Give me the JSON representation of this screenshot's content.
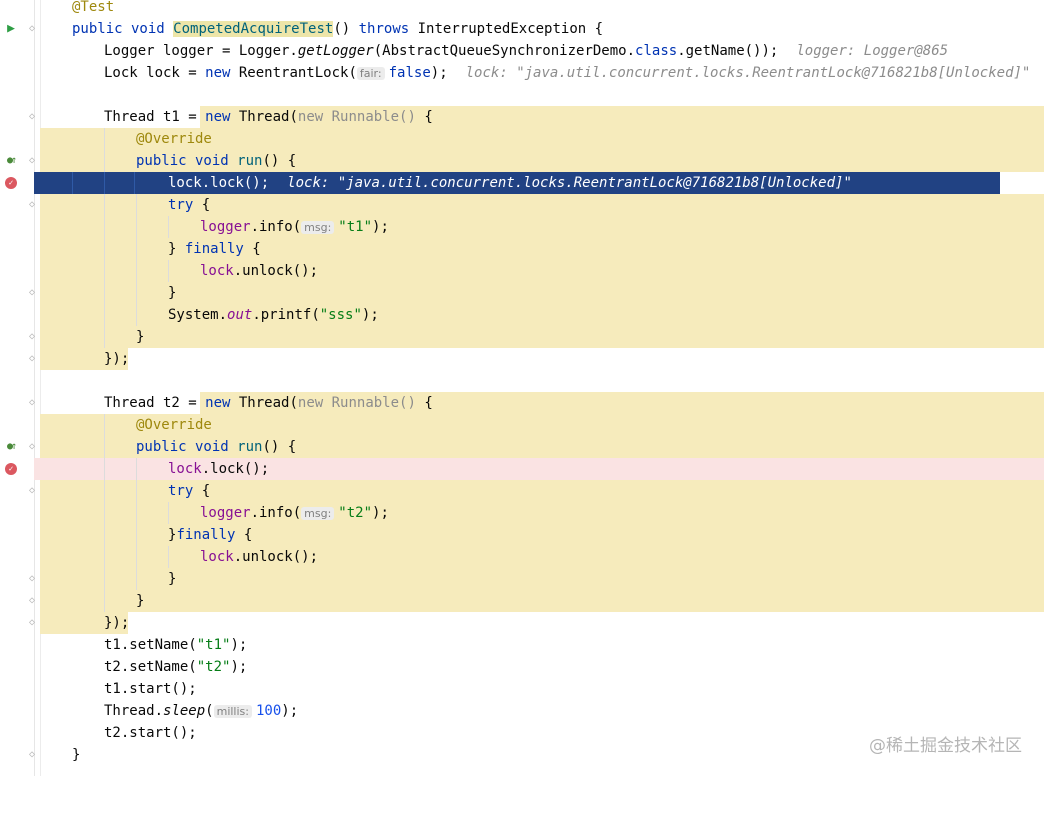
{
  "editor": {
    "lines": {
      "l0": {
        "ann": "@Test"
      },
      "l1": {
        "kw1": "public void ",
        "fn": "CompetedAcquireTest",
        "rest1": "() ",
        "kw2": "throws",
        "rest2": " InterruptedException {"
      },
      "l2": {
        "a": "Logger logger = Logger.",
        "b": "getLogger",
        "c": "(AbstractQueueSynchronizerDemo.",
        "d": "class",
        "e": ".getName());",
        "inline": "logger: Logger@865"
      },
      "l3": {
        "a": "Lock lock = ",
        "kw": "new",
        "b": " ReentrantLock(",
        "hint": "fair:",
        "kw2": "false",
        "c": ");",
        "inline": "lock: \"java.util.concurrent.locks.ReentrantLock@716821b8[Unlocked]\""
      },
      "l5": {
        "a": "Thread t1 = ",
        "kw": "new",
        "b": " Thread(",
        "faded": "new Runnable()",
        "c": " {"
      },
      "l6": {
        "ann": "@Override"
      },
      "l7": {
        "kw": "public void ",
        "fn": "run",
        "b": "() {"
      },
      "l8": {
        "fld": "lock",
        "a": ".lock();",
        "inline": "lock: \"java.util.concurrent.locks.ReentrantLock@716821b8[Unlocked]\""
      },
      "l9": {
        "kw": "try",
        "a": " {"
      },
      "l10": {
        "fld": "logger",
        "a": ".info(",
        "hint": "msg:",
        "str": "\"t1\"",
        "b": ");"
      },
      "l11": {
        "a": "} ",
        "kw": "finally",
        "b": " {"
      },
      "l12": {
        "fld": "lock",
        "a": ".unlock();"
      },
      "l13": {
        "a": "}"
      },
      "l14": {
        "a": "System.",
        "fld": "out",
        "b": ".printf(",
        "str": "\"sss\"",
        "c": ");"
      },
      "l15": {
        "a": "}"
      },
      "l16": {
        "a": "});"
      },
      "l18": {
        "a": "Thread t2 = ",
        "kw": "new",
        "b": " Thread(",
        "faded": "new Runnable()",
        "c": " {"
      },
      "l19": {
        "ann": "@Override"
      },
      "l20": {
        "kw": "public void ",
        "fn": "run",
        "b": "() {"
      },
      "l21": {
        "fld": "lock",
        "a": ".lock();"
      },
      "l22": {
        "kw": "try",
        "a": " {"
      },
      "l23": {
        "fld": "logger",
        "a": ".info(",
        "hint": "msg:",
        "str": "\"t2\"",
        "b": ");"
      },
      "l24": {
        "a": "}",
        "kw": "finally",
        "b": " {"
      },
      "l25": {
        "fld": "lock",
        "a": ".unlock();"
      },
      "l26": {
        "a": "}"
      },
      "l27": {
        "a": "}"
      },
      "l28": {
        "a": "});"
      },
      "l29": {
        "a": "t1.setName(",
        "str": "\"t1\"",
        "b": ");"
      },
      "l30": {
        "a": "t2.setName(",
        "str": "\"t2\"",
        "b": ");"
      },
      "l31": {
        "a": "t1.start();"
      },
      "l32": {
        "a": "Thread.",
        "it": "sleep",
        "b": "(",
        "hint": "millis:",
        "num": "100",
        "c": ");"
      },
      "l33": {
        "a": "t2.start();"
      },
      "l34": {
        "a": "}"
      }
    }
  },
  "gutter_icons": {
    "run": "run-test-icon",
    "override": "override-icon",
    "breakpoint": "breakpoint-icon",
    "run_glyph": "▶",
    "override_glyph": "●↑",
    "fold_glyph": "◇",
    "bp_glyph": "✓"
  },
  "watermark": "@稀土掘金技术社区",
  "colors": {
    "selection": "#214283",
    "scope_highlight": "#f6ebbc",
    "breakpoint_line": "#fae3e3",
    "keyword": "#0033b3",
    "string": "#067d17",
    "annotation": "#9e880d",
    "field": "#871094"
  }
}
